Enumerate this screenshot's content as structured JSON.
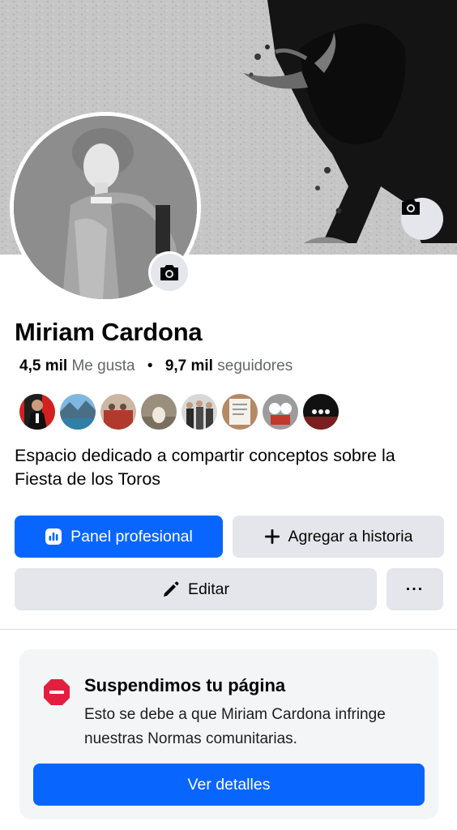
{
  "profile": {
    "name": "Miriam Cardona",
    "likes_count": "4,5 mil",
    "likes_label": "Me gusta",
    "separator": "•",
    "followers_count": "9,7 mil",
    "followers_label": "seguidores",
    "bio": "Espacio dedicado a compartir conceptos sobre la Fiesta de los Toros"
  },
  "icons": {
    "cover_camera": "camera-icon",
    "avatar_camera": "camera-icon",
    "dashboard": "bar-chart-icon",
    "add": "plus-icon",
    "edit": "pencil-icon",
    "more": "more-icon",
    "suspended": "stop-sign-icon"
  },
  "buttons": {
    "panel": "Panel profesional",
    "add_story": "Agregar a historia",
    "edit": "Editar",
    "more": "···"
  },
  "alert": {
    "title": "Suspendimos tu página",
    "text": "Esto se debe a que Miriam Cardona infringe nuestras Normas comunitarias.",
    "button": "Ver detalles"
  },
  "colors": {
    "accent": "#0866ff",
    "secondary_button": "#e4e6eb",
    "alert_red": "#e41e3f",
    "muted_text": "#65676b"
  }
}
